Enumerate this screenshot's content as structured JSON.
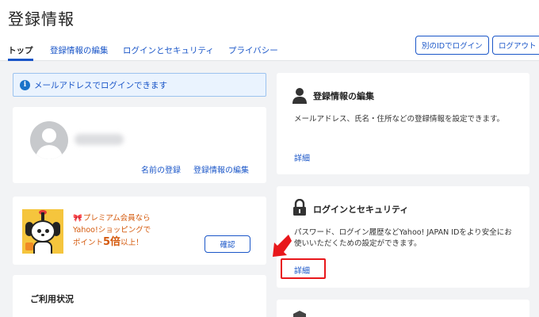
{
  "header": {
    "title": "登録情報",
    "tabs": [
      {
        "label": "トップ",
        "active": true
      },
      {
        "label": "登録情報の編集"
      },
      {
        "label": "ログインとセキュリティ"
      },
      {
        "label": "プライバシー"
      }
    ],
    "buttons": {
      "other_id_login": "別のIDでログイン",
      "logout": "ログアウト"
    }
  },
  "info_banner": {
    "icon": "info-icon",
    "text": "メールアドレスでログインできます"
  },
  "profile": {
    "links": {
      "name_register": "名前の登録",
      "edit_info": "登録情報の編集"
    }
  },
  "premium": {
    "line1": "プレミアム会員なら",
    "line2": "Yahoo!ショッピングで",
    "line3_a": "ポイント",
    "line3_b": "5倍",
    "line3_c": "以上！",
    "confirm_label": "確認"
  },
  "usage": {
    "title": "ご利用状況"
  },
  "edit_card": {
    "icon": "person-icon",
    "title": "登録情報の編集",
    "description": "メールアドレス、氏名・住所などの登録情報を設定できます。",
    "link": "詳細"
  },
  "security_card": {
    "icon": "lock-icon",
    "title": "ログインとセキュリティ",
    "description_line1": "パスワード、ログイン履歴などYahoo! JAPAN IDをより安全にお",
    "description_line2": "使いいただくための設定ができます。",
    "link": "詳細"
  },
  "colors": {
    "accent": "#1a56c8",
    "annotation": "#e8171b",
    "promo": "#d4580a"
  }
}
